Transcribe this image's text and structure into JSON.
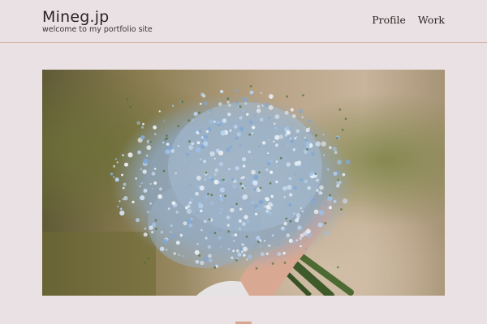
{
  "header": {
    "site_title": "Mineg.jp",
    "tagline": "welcome to my portfolio site"
  },
  "nav": {
    "items": [
      {
        "label": "Profile"
      },
      {
        "label": "Work"
      }
    ]
  },
  "hero": {
    "image": "bouquet-of-forget-me-not-flowers-photo"
  },
  "colors": {
    "background": "#e9e1e3",
    "header_rule": "#d7b3a7",
    "text": "#2a2626",
    "accent": "#d9a590"
  }
}
